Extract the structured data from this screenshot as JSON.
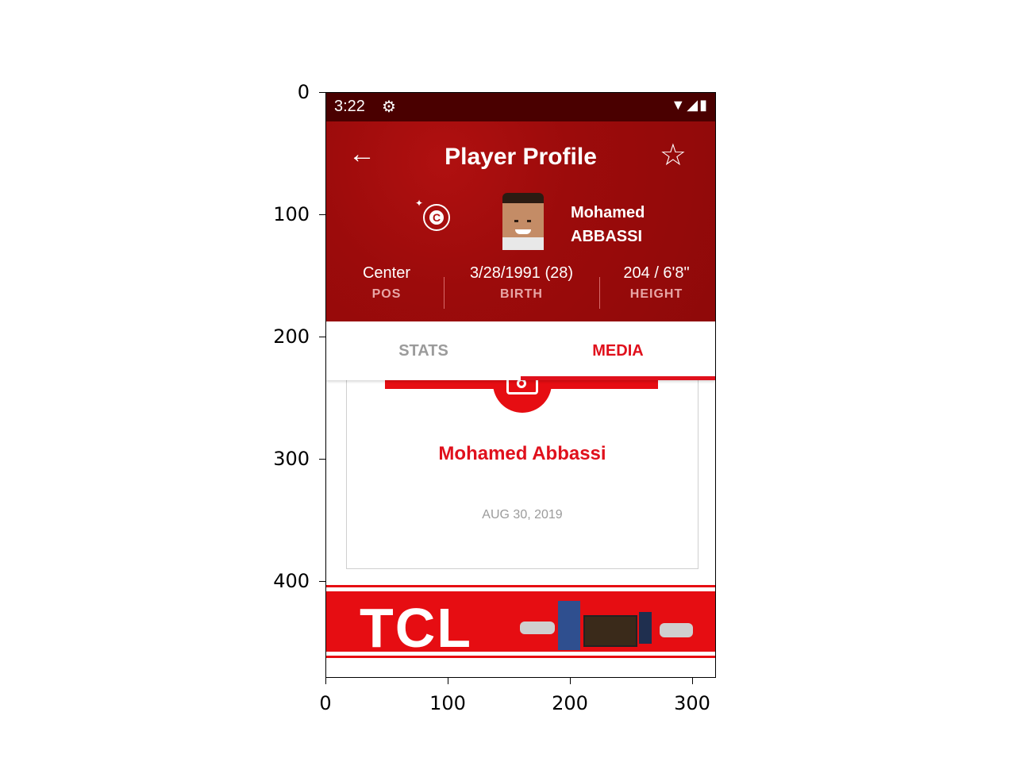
{
  "axes": {
    "y_ticks": [
      "0",
      "100",
      "200",
      "300",
      "400"
    ],
    "x_ticks": [
      "0",
      "100",
      "200",
      "300"
    ]
  },
  "status_bar": {
    "time": "3:22",
    "gear_icon": "⚙",
    "right_icons": "▼◢▮"
  },
  "header": {
    "back_icon": "←",
    "title": "Player Profile",
    "star_icon": "☆",
    "player": {
      "first_name": "Mohamed",
      "last_name": "ABBASSI"
    },
    "info": [
      {
        "value": "Center",
        "label": "POS"
      },
      {
        "value": "3/28/1991 (28)",
        "label": "BIRTH"
      },
      {
        "value": "204 / 6'8\"",
        "label": "HEIGHT"
      }
    ],
    "team_badge_letter": "C"
  },
  "tabs": {
    "stats": "STATS",
    "media": "MEDIA",
    "selected": "MEDIA",
    "accent_color": "#e0101c"
  },
  "media_item": {
    "title": "Mohamed Abbassi",
    "date": "AUG 30, 2019"
  },
  "ad": {
    "brand": "TCL",
    "background_color": "#e60d12"
  }
}
